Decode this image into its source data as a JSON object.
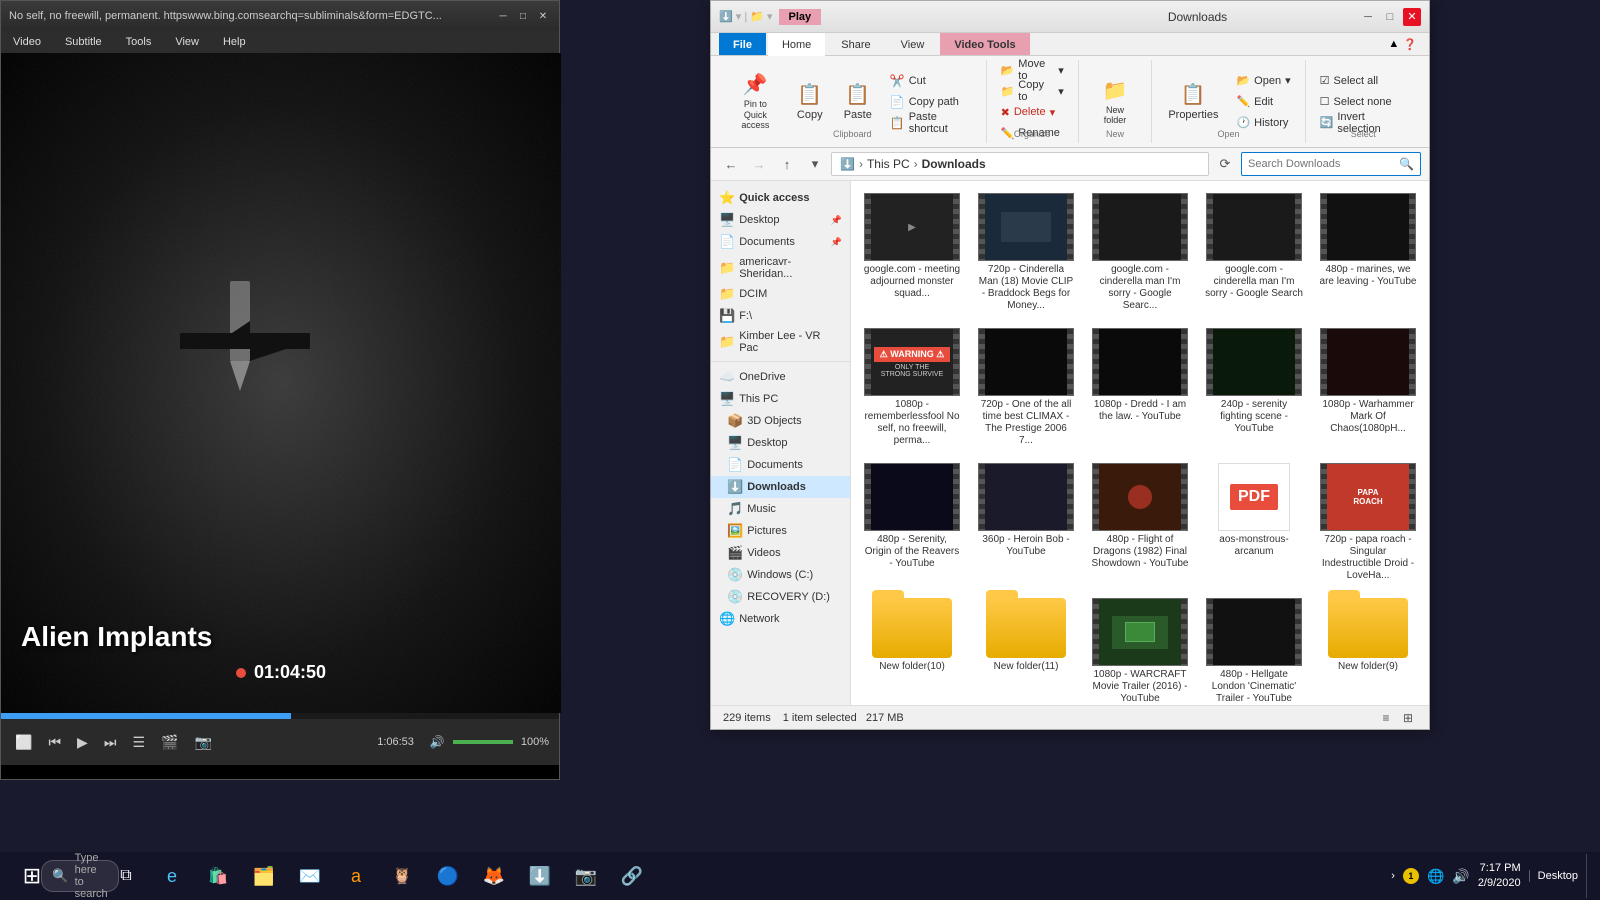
{
  "mediaPlayer": {
    "title": "No self, no freewill, permanent. httpswww.bing.comsearchq=subliminals&form=EDGTC...",
    "menus": [
      "Video",
      "Subtitle",
      "Tools",
      "View",
      "Help"
    ],
    "videoTitle": "Alien Implants",
    "timestamp": "01:04:50",
    "duration": "1:06:53",
    "volume": "100%",
    "progressPercent": 52
  },
  "fileExplorer": {
    "title": "Downloads",
    "tabs": [
      "File",
      "Home",
      "Share",
      "View",
      "Video Tools"
    ],
    "activeTab": "Home",
    "playTab": "Play",
    "ribbon": {
      "clipboard": {
        "label": "Clipboard",
        "pinToQuick": "Pin to Quick access",
        "copy": "Copy",
        "paste": "Paste",
        "cut": "Cut",
        "copyPath": "Copy path",
        "pasteShortcut": "Paste shortcut"
      },
      "organize": {
        "label": "Organize",
        "moveTo": "Move to",
        "copyTo": "Copy to",
        "delete": "Delete",
        "rename": "Rename"
      },
      "new": {
        "label": "New",
        "newFolder": "New folder"
      },
      "open": {
        "label": "Open",
        "open": "Open",
        "edit": "Edit",
        "history": "History",
        "properties": "Properties"
      },
      "select": {
        "label": "Select",
        "selectAll": "Select all",
        "selectNone": "Select none",
        "invertSelection": "Invert selection"
      }
    },
    "addressBar": {
      "path": [
        "This PC",
        "Downloads"
      ],
      "searchPlaceholder": "Search Downloads"
    },
    "sidebar": {
      "quickAccess": "Quick access",
      "items": [
        {
          "label": "Desktop",
          "icon": "🖥️",
          "pinned": true
        },
        {
          "label": "Documents",
          "icon": "📄",
          "pinned": true
        },
        {
          "label": "americavr-Sheridan...",
          "icon": "📁"
        },
        {
          "label": "DCIM",
          "icon": "📁"
        },
        {
          "label": "F:\\",
          "icon": "💾"
        },
        {
          "label": "Kimber Lee - VR Pac",
          "icon": "📁"
        }
      ],
      "places": [
        {
          "label": "OneDrive",
          "icon": "☁️"
        },
        {
          "label": "This PC",
          "icon": "🖥️"
        },
        {
          "label": "3D Objects",
          "icon": "📦"
        },
        {
          "label": "Desktop",
          "icon": "🖥️"
        },
        {
          "label": "Documents",
          "icon": "📄"
        },
        {
          "label": "Downloads",
          "icon": "⬇️",
          "active": true
        },
        {
          "label": "Music",
          "icon": "🎵"
        },
        {
          "label": "Pictures",
          "icon": "🖼️"
        },
        {
          "label": "Videos",
          "icon": "🎬"
        },
        {
          "label": "Windows (C:)",
          "icon": "💿"
        },
        {
          "label": "RECOVERY (D:)",
          "icon": "💿"
        },
        {
          "label": "Network",
          "icon": "🌐"
        }
      ]
    },
    "files": [
      {
        "type": "video",
        "name": "google.com - meeting adjourned monster squad...",
        "thumbColor": "#222",
        "thumbType": "dark"
      },
      {
        "type": "video",
        "name": "720p - Cinderella Man (18) Movie CLIP - Braddock Begs for Money...",
        "thumbColor": "#1a2a3a",
        "thumbType": "blue"
      },
      {
        "type": "video",
        "name": "google.com - cinderella man I'm sorry - Google Searc...",
        "thumbColor": "#1a1a1a",
        "thumbType": "dark"
      },
      {
        "type": "video",
        "name": "google.com - cinderella man I'm sorry - Google Search",
        "thumbColor": "#1a1a1a",
        "thumbType": "dark"
      },
      {
        "type": "video",
        "name": "480p - marines, we are leaving - YouTube",
        "thumbColor": "#111",
        "thumbType": "dark"
      },
      {
        "type": "video",
        "name": "1080p - rememberlessfool No self, no freewill, perma...",
        "thumbColor": "#222",
        "thumbType": "warning"
      },
      {
        "type": "video",
        "name": "720p - One of the all time best CLIMAX - The Prestige 2006 7...",
        "thumbColor": "#2a1a0a",
        "thumbType": "dark"
      },
      {
        "type": "video",
        "name": "1080p - Dredd - I am the law. - YouTube",
        "thumbColor": "#111",
        "thumbType": "dark"
      },
      {
        "type": "video",
        "name": "240p - serenity fighting scene - YouTube",
        "thumbColor": "#0a1a0a",
        "thumbType": "green"
      },
      {
        "type": "video",
        "name": "1080p - Warhammer Mark Of Chaos(1080pH...",
        "thumbColor": "#1a0a0a",
        "thumbType": "dark"
      },
      {
        "type": "video",
        "name": "480p - Serenity, Origin of the Reavers - YouTube",
        "thumbColor": "#0a0a1a",
        "thumbType": "blue"
      },
      {
        "type": "video",
        "name": "360p - Heroin Bob - YouTube",
        "thumbColor": "#1a1a2a",
        "thumbType": "dark"
      },
      {
        "type": "video",
        "name": "480p - Flight of Dragons (1982) Final Showdown - YouTube",
        "thumbColor": "#3a1a0a",
        "thumbType": "red"
      },
      {
        "type": "pdf",
        "name": "aos-monstrous-arcanum",
        "thumbType": "pdf"
      },
      {
        "type": "video",
        "name": "720p - papa roach - Singular Indestructible Droid - LoveHa...",
        "thumbColor": "#c0392b",
        "thumbType": "paparoach"
      },
      {
        "type": "folder",
        "name": "New folder(10)"
      },
      {
        "type": "folder",
        "name": "New folder(11)"
      },
      {
        "type": "video",
        "name": "1080p - WARCRAFT Movie Trailer (2016) - YouTube",
        "thumbColor": "#1a3a1a",
        "thumbType": "green"
      },
      {
        "type": "video",
        "name": "480p - Hellgate London 'Cinematic' Trailer - YouTube",
        "thumbColor": "#111",
        "thumbType": "dark"
      },
      {
        "type": "folder",
        "name": "New folder(9)"
      }
    ],
    "statusBar": {
      "itemCount": "229 items",
      "selected": "1 item selected",
      "size": "217 MB"
    }
  },
  "taskbar": {
    "searchPlaceholder": "Type here to search",
    "time": "7:17 PM",
    "date": "2/9/2020",
    "desktop": "Desktop",
    "volume": "🔊",
    "network": "🌐",
    "notification": "1"
  }
}
